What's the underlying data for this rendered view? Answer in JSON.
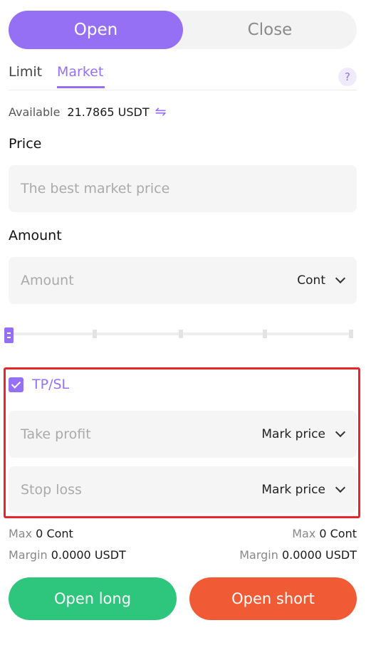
{
  "mode_toggle": {
    "open_label": "Open",
    "close_label": "Close",
    "active_color": "#9670f4"
  },
  "order_tabs": {
    "limit_label": "Limit",
    "market_label": "Market",
    "help_label": "?"
  },
  "available": {
    "label": "Available",
    "value": "21.7865 USDT",
    "swap_icon": "⇋"
  },
  "price": {
    "label": "Price",
    "placeholder": "The best market price"
  },
  "amount": {
    "label": "Amount",
    "placeholder": "Amount",
    "unit": "Cont",
    "slider_percent": 0
  },
  "tpsl": {
    "checked": true,
    "label": "TP/SL",
    "take_profit": {
      "placeholder": "Take profit",
      "trigger": "Mark price"
    },
    "stop_loss": {
      "placeholder": "Stop loss",
      "trigger": "Mark price"
    }
  },
  "long_info": {
    "max_label": "Max",
    "max_value": "0 Cont",
    "margin_label": "Margin",
    "margin_value": "0.0000 USDT"
  },
  "short_info": {
    "max_label": "Max",
    "max_value": "0 Cont",
    "margin_label": "Margin",
    "margin_value": "0.0000 USDT"
  },
  "actions": {
    "long_label": "Open long",
    "short_label": "Open short",
    "long_color": "#2ec57d",
    "short_color": "#f05a34"
  }
}
